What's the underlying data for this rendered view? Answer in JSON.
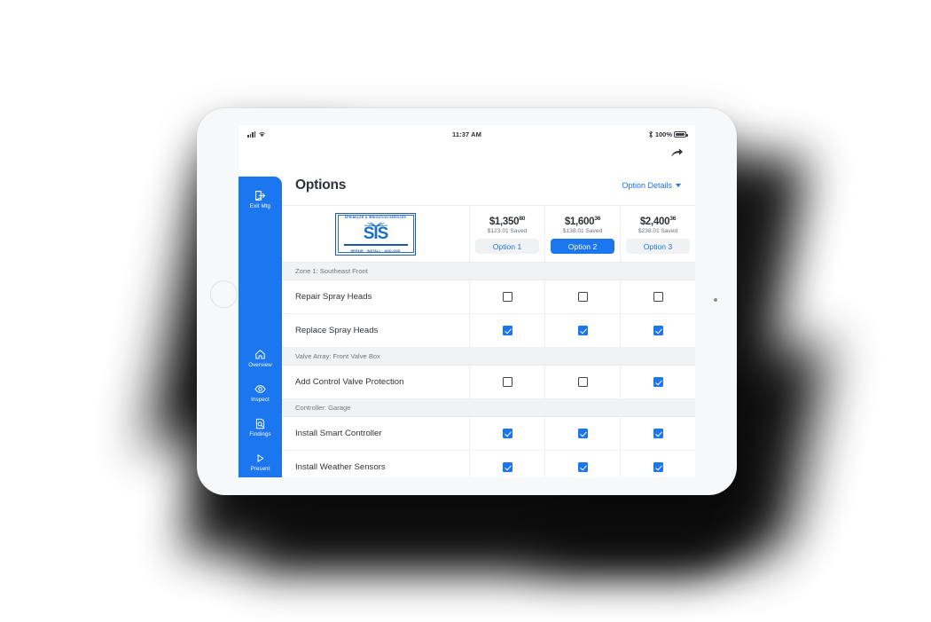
{
  "status_bar": {
    "signal_icon": "cellular-bars-icon",
    "wifi_icon": "wifi-icon",
    "time": "11:37 AM",
    "bluetooth_icon": "bluetooth-icon",
    "battery_percent": "100%",
    "battery_icon": "battery-full-icon"
  },
  "share": {
    "icon": "share-arrow-icon"
  },
  "sidebar": {
    "top_item": {
      "icon": "exit-door-icon",
      "label": "Exit Mtg"
    },
    "items": [
      {
        "icon": "home-icon",
        "label": "Overview"
      },
      {
        "icon": "eye-icon",
        "label": "Inspect"
      },
      {
        "icon": "document-search-icon",
        "label": "Findings"
      },
      {
        "icon": "play-icon",
        "label": "Present"
      }
    ]
  },
  "header": {
    "title": "Options",
    "option_details_label": "Option Details",
    "caret_icon": "chevron-down-icon"
  },
  "logo": {
    "top_text": "SPRINKLER & IRRIGATION SERVICES",
    "mark": "SIS",
    "bottom_text": "REPAIR  ·  INSTALL  ·  ADD-ONS"
  },
  "options": [
    {
      "price_main": "$1,350",
      "price_cents": "80",
      "saved": "$123.01 Saved",
      "button_label": "Option 1",
      "selected": false
    },
    {
      "price_main": "$1,600",
      "price_cents": "36",
      "saved": "$138.01 Saved",
      "button_label": "Option 2",
      "selected": true
    },
    {
      "price_main": "$2,400",
      "price_cents": "36",
      "saved": "$238.01 Saved",
      "button_label": "Option 3",
      "selected": false
    }
  ],
  "table": {
    "groups": [
      {
        "title": "Zone 1: Southeast Front",
        "rows": [
          {
            "label": "Repair Spray Heads",
            "checks": [
              false,
              false,
              false
            ]
          },
          {
            "label": "Replace Spray Heads",
            "checks": [
              true,
              true,
              true
            ]
          }
        ]
      },
      {
        "title": "Valve Array: Front Valve Box",
        "rows": [
          {
            "label": "Add Control Valve Protection",
            "checks": [
              false,
              false,
              true
            ]
          }
        ]
      },
      {
        "title": "Controller: Garage",
        "rows": [
          {
            "label": "Install Smart Controller",
            "checks": [
              true,
              true,
              true
            ]
          },
          {
            "label": "Install Weather Sensors",
            "checks": [
              true,
              true,
              true
            ]
          }
        ]
      }
    ]
  },
  "colors": {
    "accent_blue": "#1b76ef",
    "group_bg": "#f1f2f4",
    "text_dark": "#2f3337",
    "text_muted": "#70767c",
    "logo_blue": "#1a5ba8"
  }
}
